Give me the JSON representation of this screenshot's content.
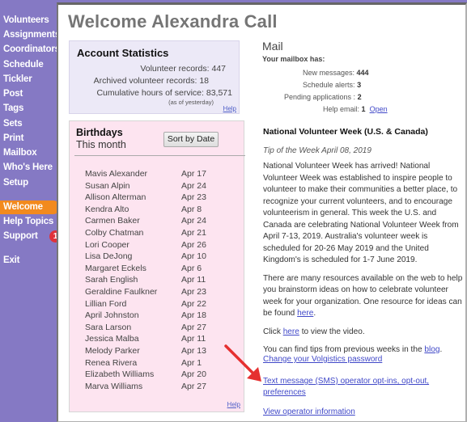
{
  "sidebar": {
    "items": [
      {
        "label": "Volunteers"
      },
      {
        "label": "Assignments"
      },
      {
        "label": "Coordinators"
      },
      {
        "label": "Schedule"
      },
      {
        "label": "Tickler"
      },
      {
        "label": "Post"
      },
      {
        "label": "Tags"
      },
      {
        "label": "Sets"
      },
      {
        "label": "Print"
      },
      {
        "label": "Mailbox"
      },
      {
        "label": "Who's Here"
      },
      {
        "label": "Setup"
      },
      {
        "label": "Welcome",
        "active": true
      },
      {
        "label": "Help Topics"
      },
      {
        "label": "Support",
        "badge": "1"
      },
      {
        "label": "Exit"
      }
    ],
    "active_color": "#f28a1e",
    "background_color": "#8579c4",
    "badge_color": "#e0323a"
  },
  "header": {
    "title": "Welcome Alexandra Call"
  },
  "account_stats": {
    "title": "Account Statistics",
    "rows": [
      {
        "label": "Volunteer records:",
        "value": "447"
      },
      {
        "label": "Archived volunteer records:",
        "value": "18"
      },
      {
        "label": "Cumulative hours of service:",
        "value": "83,571"
      }
    ],
    "note": "(as of yesterday)",
    "help_label": "Help"
  },
  "birthdays": {
    "title": "Birthdays",
    "subtitle": "This month",
    "sort_button": "Sort by Date",
    "help_label": "Help",
    "rows": [
      {
        "name": "Mavis Alexander",
        "date": "Apr 17"
      },
      {
        "name": "Susan Alpin",
        "date": "Apr 24"
      },
      {
        "name": "Allison Alterman",
        "date": "Apr 23"
      },
      {
        "name": "Kendra Alto",
        "date": "Apr 8"
      },
      {
        "name": "Carmen Baker",
        "date": "Apr 24"
      },
      {
        "name": "Colby Chatman",
        "date": "Apr 21"
      },
      {
        "name": "Lori Cooper",
        "date": "Apr 26"
      },
      {
        "name": "Lisa DeJong",
        "date": "Apr 10"
      },
      {
        "name": "Margaret Eckels",
        "date": "Apr 6"
      },
      {
        "name": "Sarah English",
        "date": "Apr 11"
      },
      {
        "name": "Geraldine Faulkner",
        "date": "Apr 23"
      },
      {
        "name": "Lillian Ford",
        "date": "Apr 22"
      },
      {
        "name": "April Johnston",
        "date": "Apr 18"
      },
      {
        "name": "Sara Larson",
        "date": "Apr 27"
      },
      {
        "name": "Jessica Malba",
        "date": "Apr 11"
      },
      {
        "name": "Melody Parker",
        "date": "Apr 13"
      },
      {
        "name": "Renea Rivera",
        "date": "Apr 1"
      },
      {
        "name": "Elizabeth Williams",
        "date": "Apr 20"
      },
      {
        "name": "Marva Williams",
        "date": "Apr 27"
      }
    ]
  },
  "mail": {
    "title": "Mail",
    "subtitle": "Your mailbox has:",
    "rows": [
      {
        "label": "New messages:",
        "value": "444"
      },
      {
        "label": "Schedule alerts:",
        "value": "3"
      },
      {
        "label": "Pending applications :",
        "value": "2"
      },
      {
        "label": "Help email:",
        "value": "1"
      }
    ],
    "open_link": "Open"
  },
  "tip": {
    "title": "National Volunteer Week (U.S. & Canada)",
    "date": "Tip of the Week April 08, 2019",
    "paragraph1": "National Volunteer Week has arrived! National Volunteer Week was established to inspire people to volunteer to make their communities a better place, to recognize your current volunteers, and to encourage volunteerism in general. This week the U.S. and Canada are celebrating National Volunteer Week from April 7-13, 2019. Australia's volunteer week is scheduled for 20-26 May 2019 and the United Kingdom's is scheduled for 1-7 June 2019.",
    "paragraph2_prefix": "There are many resources available on the web to help you brainstorm ideas on how to celebrate volunteer week for your organization. One resource for ideas can be found ",
    "paragraph2_link": "here",
    "paragraph2_suffix": ".",
    "paragraph3_prefix": "Click ",
    "paragraph3_link": "here",
    "paragraph3_suffix": " to view the video.",
    "paragraph4_prefix": "You can find tips from previous weeks in the ",
    "paragraph4_link": "blog",
    "paragraph4_suffix": "."
  },
  "links": {
    "change_password": "Change your Volgistics password",
    "sms_preferences": "Text message (SMS) operator opt-ins, opt-out, preferences",
    "operator_info": "View operator information"
  },
  "annotation": {
    "arrow_color": "#e53030"
  }
}
